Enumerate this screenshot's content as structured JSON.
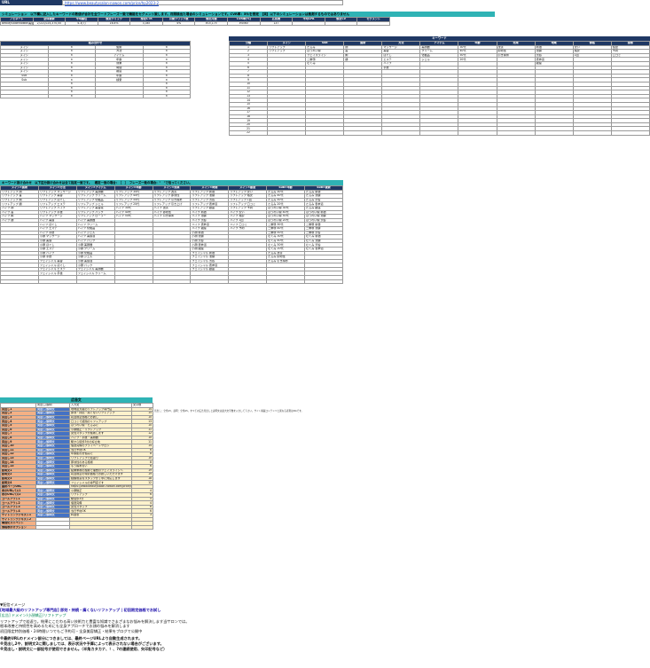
{
  "top": {
    "url_label": "URL",
    "url_value": "https://www.beautysalon-nowon.com/price/hp2023-2"
  },
  "sim": {
    "banner": "シミュレーション　以下欄に記入したキーワードの数値が合計を全ワードフレーズ一致で機能をセグメント致します。月間検出た場合のシミュレーションです。CVR率：5％を想定　【実】以下のシミュレーションは推測するものではありません",
    "headers": [
      "ノミネート",
      "全体検索",
      "平均順位",
      "想定クリック",
      "想定CTR",
      "月間クリック数",
      "想定月額",
      "CVR率(%)",
      "広告費",
      "平均CPA",
      "想定CV",
      "セグメント"
    ],
    "row": [
      "BeautySalonNowon美容",
      "2,023,024,370,00",
      "4.3(7)",
      "16.4%",
      "3,387",
      "4%",
      "¥15,175",
      "¥4560",
      "137",
      "",
      "",
      ""
    ]
  },
  "combo": {
    "title": "組み合わせ",
    "rows": [
      [
        "メイン",
        "×",
        "施術",
        "×"
      ],
      [
        "メイン",
        "×",
        "方法",
        "×"
      ],
      [
        "メイン",
        "×",
        "アイテム",
        "×"
      ],
      [
        "メイン",
        "×",
        "年齢",
        "×"
      ],
      [
        "メイン",
        "×",
        "効果",
        "×"
      ],
      [
        "メイン",
        "×",
        "時間",
        "×"
      ],
      [
        "メイン",
        "×",
        "都度",
        "×"
      ],
      [
        "Sub",
        "×",
        "年齢",
        "×"
      ],
      [
        "Sub",
        "×",
        "検索",
        "×"
      ],
      [
        "",
        "×",
        "",
        "×"
      ],
      [
        "",
        "×",
        "",
        "×"
      ],
      [
        "",
        "×",
        "",
        "×"
      ],
      [
        "",
        "×",
        "",
        "×"
      ]
    ]
  },
  "kw": {
    "title": "キーワード",
    "headers": [
      "分類",
      "メイン",
      "Sub",
      "施術",
      "方法",
      "アイテム",
      "年齢",
      "効果",
      "地域",
      "価格",
      "接客"
    ],
    "rows": [
      [
        "1",
        "リフトアップ",
        "たるみ",
        "顔",
        "マッサージ",
        "美顔器",
        "30代",
        "改善",
        "新宿",
        "安い",
        "個室"
      ],
      [
        "2",
        "リフトアップ",
        "ほうれい線",
        "首",
        "美容",
        "クリーム",
        "40代",
        "即効性",
        "池袋",
        "格安",
        "予約"
      ],
      [
        "3",
        "",
        "フェイスライン",
        "頬",
        "ほぐし",
        "化粧品",
        "50代",
        "引き締め",
        "渋谷",
        "1回",
        "口コミ"
      ],
      [
        "4",
        "",
        "二重顎",
        "額",
        "エステ",
        "ジェル",
        "20代",
        "",
        "表参道",
        "",
        ""
      ],
      [
        "5",
        "",
        "むくみ",
        "",
        "ハイフ",
        "",
        "",
        "",
        "銀座",
        "",
        ""
      ],
      [
        "6",
        "",
        "",
        "",
        "手技",
        "",
        "",
        "",
        "",
        "",
        ""
      ],
      [
        "7",
        "",
        "",
        "",
        "",
        "",
        "",
        "",
        "",
        "",
        ""
      ],
      [
        "8",
        "",
        "",
        "",
        "",
        "",
        "",
        "",
        "",
        "",
        ""
      ],
      [
        "9",
        "",
        "",
        "",
        "",
        "",
        "",
        "",
        "",
        "",
        ""
      ],
      [
        "10",
        "",
        "",
        "",
        "",
        "",
        "",
        "",
        "",
        "",
        ""
      ],
      [
        "11",
        "",
        "",
        "",
        "",
        "",
        "",
        "",
        "",
        "",
        ""
      ],
      [
        "12",
        "",
        "",
        "",
        "",
        "",
        "",
        "",
        "",
        "",
        ""
      ],
      [
        "13",
        "",
        "",
        "",
        "",
        "",
        "",
        "",
        "",
        "",
        ""
      ],
      [
        "14",
        "",
        "",
        "",
        "",
        "",
        "",
        "",
        "",
        "",
        ""
      ],
      [
        "15",
        "",
        "",
        "",
        "",
        "",
        "",
        "",
        "",
        "",
        ""
      ],
      [
        "16",
        "",
        "",
        "",
        "",
        "",
        "",
        "",
        "",
        "",
        ""
      ],
      [
        "17",
        "",
        "",
        "",
        "",
        "",
        "",
        "",
        "",
        "",
        ""
      ],
      [
        "18",
        "",
        "",
        "",
        "",
        "",
        "",
        "",
        "",
        "",
        ""
      ],
      [
        "19",
        "",
        "",
        "",
        "",
        "",
        "",
        "",
        "",
        "",
        ""
      ],
      [
        "20",
        "",
        "",
        "",
        "",
        "",
        "",
        "",
        "",
        "",
        ""
      ],
      [
        "21",
        "",
        "",
        "",
        "",
        "",
        "",
        "",
        "",
        "",
        ""
      ],
      [
        "22",
        "",
        "",
        "",
        "",
        "",
        "",
        "",
        "",
        "",
        ""
      ]
    ]
  },
  "combos": {
    "banner": "キーワード掛け合わせ　以下区分掛け合わせは全て指定一致です。　確定一致の場合：［　］　フレーズ一致の場合：\"　\"で括ってください。",
    "headers": [
      "メイン×施術",
      "メイン×方法",
      "メイン×アイテム",
      "メイン×年齢",
      "メイン×効果",
      "メイン×時間",
      "メイン×都度",
      "Sub×年齢",
      "Sub×検索"
    ],
    "rows": [
      [
        "リフトアップ 顔",
        "リフトアップ マッサージ",
        "リフトアップ 美顔器",
        "リフトアップ 30代",
        "リフトアップ 改善",
        "リフトアップ 新宿",
        "リフトアップ 安い",
        "たるみ 30代",
        "たるみ 新宿"
      ],
      [
        "リフトアップ 首",
        "リフトアップ 美容",
        "リフトアップ クリーム",
        "リフトアップ 40代",
        "リフトアップ 即効性",
        "リフトアップ 池袋",
        "リフトアップ 格安",
        "たるみ 40代",
        "たるみ 池袋"
      ],
      [
        "リフトアップ 頬",
        "リフトアップ ほぐし",
        "リフトアップ 化粧品",
        "リフトアップ 50代",
        "リフトアップ 引き締め",
        "リフトアップ 渋谷",
        "リフトアップ 1回",
        "たるみ 50代",
        "たるみ 渋谷"
      ],
      [
        "リフトアップ 額",
        "リフトアップ エステ",
        "リフトアップ ジェル",
        "リフトアップ 20代",
        "リフトアップ 引き上げ",
        "リフトアップ 表参道",
        "リフトアップ 口コミ",
        "たるみ 20代",
        "たるみ 表参道"
      ],
      [
        "ハイフ 顔",
        "リフトアップ ハイフ",
        "リフトアップ 美容液",
        "ハイフ 30代",
        "ハイフ 改善",
        "リフトアップ 銀座",
        "リフトアップ 予約",
        "ほうれい線 30代",
        "たるみ 銀座"
      ],
      [
        "ハイフ 首",
        "リフトアップ 手技",
        "リフトアップ パック",
        "ハイフ 40代",
        "ハイフ 即効性",
        "ハイフ 新宿",
        "ハイフ 安い",
        "ほうれい線 40代",
        "ほうれい線 新宿"
      ],
      [
        "ハイフ 頬",
        "ハイフ マッサージ",
        "リフトアップ ローラー",
        "ハイフ 50代",
        "ハイフ 引き締め",
        "ハイフ 池袋",
        "ハイフ 格安",
        "ほうれい線 50代",
        "ほうれい線 池袋"
      ],
      [
        "ハイフ 額",
        "ハイフ 美容",
        "ハイフ 美顔器",
        "",
        "",
        "ハイフ 渋谷",
        "ハイフ 1回",
        "ほうれい線 20代",
        "ほうれい線 渋谷"
      ],
      [
        "",
        "ハイフ ほぐし",
        "ハイフ クリーム",
        "",
        "",
        "ハイフ 表参道",
        "ハイフ 口コミ",
        "二重顎 30代",
        "二重顎 新宿"
      ],
      [
        "",
        "ハイフ エステ",
        "ハイフ 化粧品",
        "",
        "",
        "ハイフ 銀座",
        "ハイフ 予約",
        "二重顎 40代",
        "二重顎 池袋"
      ],
      [
        "",
        "ハイフ 手技",
        "ハイフ ジェル",
        "",
        "",
        "小顔 新宿",
        "",
        "二重顎 50代",
        "二重顎 渋谷"
      ],
      [
        "",
        "小顔 マッサージ",
        "ハイフ 美容液",
        "",
        "",
        "小顔 池袋",
        "",
        "むくみ 30代",
        "むくみ 新宿"
      ],
      [
        "",
        "小顔 美容",
        "ハイフ パック",
        "",
        "",
        "小顔 渋谷",
        "",
        "むくみ 40代",
        "むくみ 池袋"
      ],
      [
        "",
        "小顔 ほぐし",
        "小顔 美顔器",
        "",
        "",
        "小顔 表参道",
        "",
        "むくみ 50代",
        "むくみ 渋谷"
      ],
      [
        "",
        "小顔 エステ",
        "小顔 クリーム",
        "",
        "",
        "小顔 銀座",
        "",
        "むくみ 20代",
        "むくみ 表参道"
      ],
      [
        "",
        "小顔 ハイフ",
        "小顔 化粧品",
        "",
        "",
        "フェイシャル 新宿",
        "",
        "たるみ 改善",
        ""
      ],
      [
        "",
        "小顔 手技",
        "小顔 ジェル",
        "",
        "",
        "フェイシャル 池袋",
        "",
        "たるみ 即効性",
        ""
      ],
      [
        "",
        "フェイシャル 美容",
        "小顔 美容液",
        "",
        "",
        "フェイシャル 渋谷",
        "",
        "たるみ 引き締め",
        ""
      ],
      [
        "",
        "フェイシャル ほぐし",
        "小顔 パック",
        "",
        "",
        "フェイシャル 表参道",
        "",
        "",
        ""
      ],
      [
        "",
        "フェイシャル エステ",
        "フェイシャル 美顔器",
        "",
        "",
        "フェイシャル 銀座",
        "",
        "",
        ""
      ],
      [
        "",
        "フェイシャル 手技",
        "フェイシャル クリーム",
        "",
        "",
        "",
        "",
        "",
        ""
      ],
      [
        "",
        "",
        "",
        "",
        "",
        "",
        "",
        "",
        ""
      ],
      [
        "",
        "",
        "",
        "",
        "",
        "",
        "",
        "",
        ""
      ]
    ]
  },
  "ads": {
    "title": "広告文",
    "headers": [
      "",
      "見出し/説明",
      "入力文",
      "文字数"
    ],
    "side_note": "見出し：全角15、説明：全角45。すべての広告見出しと説明文は最大文字数を入力して下さい。サイト掲載コンテンツと異なる表現はNGです。",
    "rows": [
      [
        "見出し1",
        "見出し/説明文",
        "地域最大級のリフトアップ専門店",
        "14"
      ],
      [
        "見出し2",
        "見出し/説明文",
        "即効・持続・痛くないリフトアップ",
        "15"
      ],
      [
        "見出し3",
        "見出し/説明文",
        "初回限定価格でお試し",
        "10"
      ],
      [
        "見出し4",
        "見出し/説明文",
        "口コミで話題のリフトアップ",
        "13"
      ],
      [
        "見出し5",
        "見出し/説明文",
        "ほうれい線・たるみに",
        "10"
      ],
      [
        "見出し6",
        "見出し/説明文",
        "小顔矯正・リフトアップ",
        "11"
      ],
      [
        "見出し7",
        "見出し/説明文",
        "女性スタッフが施術します",
        "12"
      ],
      [
        "見出し8",
        "見出し/説明文",
        "ハイフ・手技・美顔器",
        "10"
      ],
      [
        "見出し9",
        "見出し/説明文",
        "駅から徒歩3分の好立地",
        "11"
      ],
      [
        "見出し10",
        "見出し/説明文",
        "個室完備のプライベートサロン",
        "14"
      ],
      [
        "見出し11",
        "見出し/説明文",
        "当日予約OK",
        "6"
      ],
      [
        "見出し12",
        "見出し/説明文",
        "年齢肌のお悩みに",
        "8"
      ],
      [
        "見出し13",
        "見出し/説明文",
        "リフトアップで若返り",
        "10"
      ],
      [
        "見出し14",
        "見出し/説明文",
        "即効性のある施術",
        "8"
      ],
      [
        "見出し15",
        "見出し/説明文",
        "もう諦めない",
        "6"
      ],
      [
        "説明文1",
        "見出し/説明文",
        "結果重視の施術で理想のフェイスラインへ",
        "19"
      ],
      [
        "説明文2",
        "見出し/説明文",
        "初回限定の特別価格でお試しいただけます",
        "19"
      ],
      [
        "説明文3",
        "見出し/説明文",
        "経験豊富なスタッフが丁寧に対応します",
        "18"
      ],
      [
        "説明文4",
        "見出し/説明文",
        "フェイシャルの専門店です",
        "12"
      ],
      [
        "最終ページURL",
        "",
        "https://www.beautysalon-nowon.com/price/hp2023-2",
        ""
      ],
      [
        "表示URLパス1",
        "見出し/説明文",
        "小顔矯正",
        "4"
      ],
      [
        "表示URLパス2",
        "見出し/説明文",
        "リフトアップ",
        "6"
      ],
      [
        "コールアウト1",
        "見出し/説明文",
        "駅徒歩3分",
        "5"
      ],
      [
        "コールアウト2",
        "見出し/説明文",
        "個室完備",
        "4"
      ],
      [
        "コールアウト3",
        "見出し/説明文",
        "女性スタッフ",
        "6"
      ],
      [
        "コールアウト4",
        "見出し/説明文",
        "当日予約OK",
        "6"
      ],
      [
        "サイトリンクテキスト1",
        "見出し/説明文",
        "料金表",
        "3"
      ],
      [
        "サイトリンクテキスト2",
        "",
        "",
        ""
      ],
      [
        "構造化スニペット",
        "",
        "",
        ""
      ],
      [
        "価格表示オプション",
        "",
        "",
        ""
      ]
    ]
  },
  "preview": {
    "label": "▼配信イメージ",
    "headline": "[地域最大級のリフトアップ専門店] 即効・持続・痛くないリフトアップ | 初回限定価格でお試し",
    "display_url": "[広告] ドメイン/小顔矯正/リフトアップ",
    "desc1": "リフトアップで若返り。結果にこだわる高い技術力と豊富な知識でさまざまなお悩みを解決します当サロンでは。",
    "desc2": "根本改善と持続性を高めるためにも全身アプローチでお顔の悩みを解消します",
    "desc3": "初回限定特別価格・24時間いつでもご予約可・全身美容矯正・結果をブログで公開中",
    "note1": "※最終URLのドメイン部分につきましては、最終ページURLより自動生成されます。",
    "note2": "※見出し2や、説明文2に関しましては、表示状況や予算によって表示されない場合がございます。",
    "note3": "※見出し・説明文に一部記号が使用できません。（半角カタカナ、！、?の連続使用、矢印記号など）"
  }
}
